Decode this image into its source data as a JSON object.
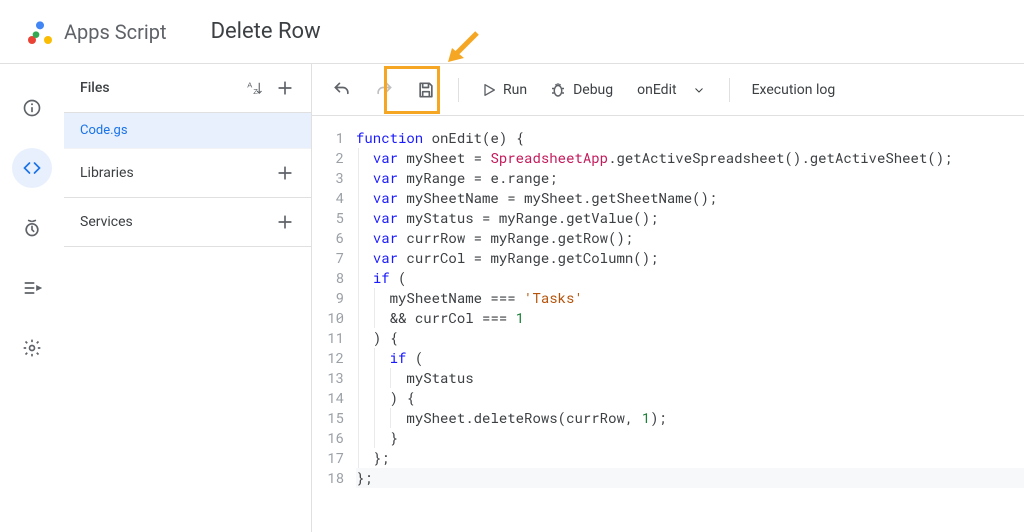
{
  "header": {
    "product": "Apps Script",
    "project_title": "Delete Row"
  },
  "rail": {
    "items": [
      "overview",
      "editor",
      "triggers",
      "executions",
      "settings"
    ]
  },
  "files_panel": {
    "title": "Files",
    "file": "Code.gs",
    "libraries": "Libraries",
    "services": "Services"
  },
  "toolbar": {
    "run": "Run",
    "debug": "Debug",
    "function": "onEdit",
    "exec_log": "Execution log"
  },
  "code": {
    "lines": [
      {
        "n": 1,
        "tokens": [
          {
            "t": "function ",
            "c": "kw"
          },
          {
            "t": "onEdit",
            "c": "fn"
          },
          {
            "t": "(",
            "c": "plain"
          },
          {
            "t": "e",
            "c": "fn"
          },
          {
            "t": ") {",
            "c": "plain"
          }
        ]
      },
      {
        "n": 2,
        "indent": 1,
        "tokens": [
          {
            "t": "var ",
            "c": "kw"
          },
          {
            "t": "mySheet",
            "c": "fn"
          },
          {
            "t": " = ",
            "c": "plain"
          },
          {
            "t": "SpreadsheetApp",
            "c": "cls"
          },
          {
            "t": ".",
            "c": "plain"
          },
          {
            "t": "getActiveSpreadsheet",
            "c": "fn"
          },
          {
            "t": "().",
            "c": "plain"
          },
          {
            "t": "getActiveSheet",
            "c": "fn"
          },
          {
            "t": "();",
            "c": "plain"
          }
        ]
      },
      {
        "n": 3,
        "indent": 1,
        "tokens": [
          {
            "t": "var ",
            "c": "kw"
          },
          {
            "t": "myRange",
            "c": "fn"
          },
          {
            "t": " = ",
            "c": "plain"
          },
          {
            "t": "e",
            "c": "fn"
          },
          {
            "t": ".",
            "c": "plain"
          },
          {
            "t": "range",
            "c": "fn"
          },
          {
            "t": ";",
            "c": "plain"
          }
        ]
      },
      {
        "n": 4,
        "indent": 1,
        "tokens": [
          {
            "t": "var ",
            "c": "kw"
          },
          {
            "t": "mySheetName",
            "c": "fn"
          },
          {
            "t": " = ",
            "c": "plain"
          },
          {
            "t": "mySheet",
            "c": "fn"
          },
          {
            "t": ".",
            "c": "plain"
          },
          {
            "t": "getSheetName",
            "c": "fn"
          },
          {
            "t": "();",
            "c": "plain"
          }
        ]
      },
      {
        "n": 5,
        "indent": 1,
        "tokens": [
          {
            "t": "var ",
            "c": "kw"
          },
          {
            "t": "myStatus",
            "c": "fn"
          },
          {
            "t": " = ",
            "c": "plain"
          },
          {
            "t": "myRange",
            "c": "fn"
          },
          {
            "t": ".",
            "c": "plain"
          },
          {
            "t": "getValue",
            "c": "fn"
          },
          {
            "t": "();",
            "c": "plain"
          }
        ]
      },
      {
        "n": 6,
        "indent": 1,
        "tokens": [
          {
            "t": "var ",
            "c": "kw"
          },
          {
            "t": "currRow",
            "c": "fn"
          },
          {
            "t": " = ",
            "c": "plain"
          },
          {
            "t": "myRange",
            "c": "fn"
          },
          {
            "t": ".",
            "c": "plain"
          },
          {
            "t": "getRow",
            "c": "fn"
          },
          {
            "t": "();",
            "c": "plain"
          }
        ]
      },
      {
        "n": 7,
        "indent": 1,
        "tokens": [
          {
            "t": "var ",
            "c": "kw"
          },
          {
            "t": "currCol",
            "c": "fn"
          },
          {
            "t": " = ",
            "c": "plain"
          },
          {
            "t": "myRange",
            "c": "fn"
          },
          {
            "t": ".",
            "c": "plain"
          },
          {
            "t": "getColumn",
            "c": "fn"
          },
          {
            "t": "();",
            "c": "plain"
          }
        ]
      },
      {
        "n": 8,
        "indent": 1,
        "tokens": [
          {
            "t": "if ",
            "c": "kw"
          },
          {
            "t": "(",
            "c": "plain"
          }
        ]
      },
      {
        "n": 9,
        "indent": 2,
        "tokens": [
          {
            "t": "mySheetName",
            "c": "fn"
          },
          {
            "t": " === ",
            "c": "plain"
          },
          {
            "t": "'Tasks'",
            "c": "str"
          }
        ]
      },
      {
        "n": 10,
        "indent": 2,
        "tokens": [
          {
            "t": "&& ",
            "c": "plain"
          },
          {
            "t": "currCol",
            "c": "fn"
          },
          {
            "t": " === ",
            "c": "plain"
          },
          {
            "t": "1",
            "c": "num"
          }
        ]
      },
      {
        "n": 11,
        "indent": 1,
        "tokens": [
          {
            "t": ") {",
            "c": "plain"
          }
        ]
      },
      {
        "n": 12,
        "indent": 2,
        "tokens": [
          {
            "t": "if ",
            "c": "kw"
          },
          {
            "t": "(",
            "c": "plain"
          }
        ]
      },
      {
        "n": 13,
        "indent": 3,
        "tokens": [
          {
            "t": "myStatus",
            "c": "fn"
          }
        ]
      },
      {
        "n": 14,
        "indent": 2,
        "tokens": [
          {
            "t": ") {",
            "c": "plain"
          }
        ]
      },
      {
        "n": 15,
        "indent": 3,
        "tokens": [
          {
            "t": "mySheet",
            "c": "fn"
          },
          {
            "t": ".",
            "c": "plain"
          },
          {
            "t": "deleteRows",
            "c": "fn"
          },
          {
            "t": "(",
            "c": "plain"
          },
          {
            "t": "currRow",
            "c": "fn"
          },
          {
            "t": ", ",
            "c": "plain"
          },
          {
            "t": "1",
            "c": "num"
          },
          {
            "t": ");",
            "c": "plain"
          }
        ]
      },
      {
        "n": 16,
        "indent": 2,
        "tokens": [
          {
            "t": "}",
            "c": "plain"
          }
        ]
      },
      {
        "n": 17,
        "indent": 1,
        "tokens": [
          {
            "t": "};",
            "c": "plain"
          }
        ]
      },
      {
        "n": 18,
        "cursor": true,
        "tokens": [
          {
            "t": "};",
            "c": "plain"
          }
        ]
      }
    ]
  },
  "annotation": {
    "highlight": "save",
    "arrow_color": "#f5a623"
  }
}
